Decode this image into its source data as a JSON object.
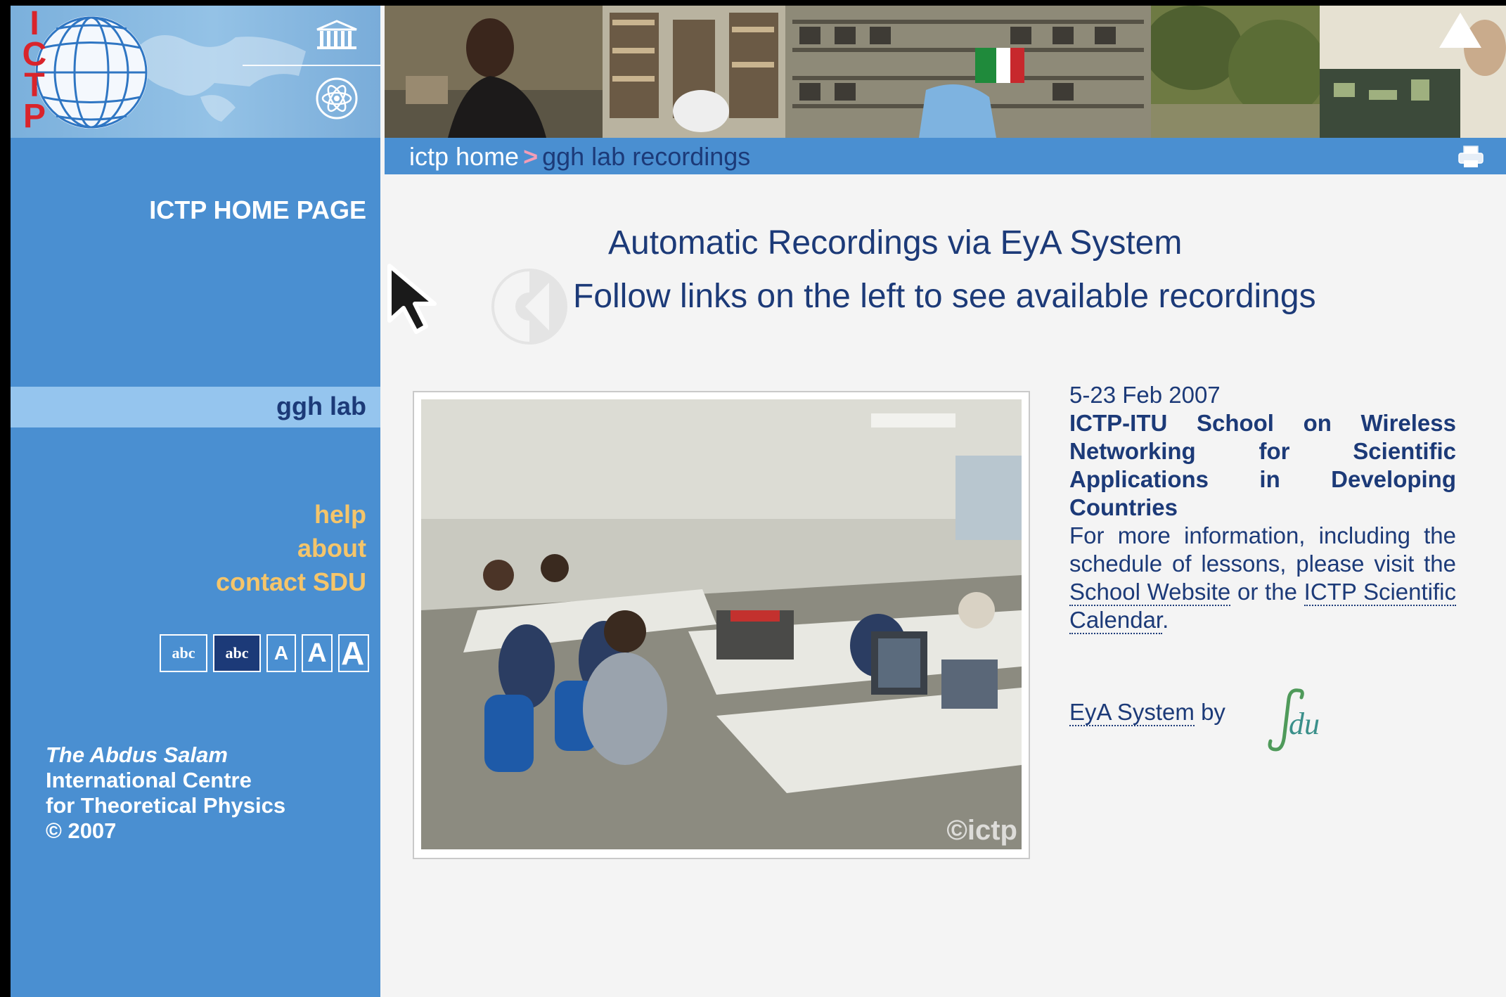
{
  "header": {
    "logo_letters": "ICTP"
  },
  "breadcrumb": {
    "home": "ictp home",
    "separator": ">",
    "current": "ggh lab recordings"
  },
  "sidebar": {
    "home_link": "ICTP HOME PAGE",
    "selected_item": "ggh lab",
    "links": [
      "help",
      "about",
      "contact SDU"
    ],
    "font_controls": [
      "abc",
      "abc",
      "A",
      "A",
      "A"
    ],
    "copyright": {
      "line1": "The Abdus Salam",
      "line2": "International Centre",
      "line3": "for Theoretical Physics",
      "line4": "© 2007"
    }
  },
  "main": {
    "headline": "Automatic Recordings via EyA System",
    "subline": "Follow links on the left to see available recordings",
    "photo_credit": "©ictp"
  },
  "event": {
    "date": "5-23 Feb 2007",
    "title": "ICTP-ITU School on Wireless Networking for Scientific Applications in Developing Countries",
    "more_prefix": "For more information, including the schedule of lessons, please visit the",
    "school_link": "School Website",
    "more_middle": "or the",
    "calendar_link": "ICTP Scientific Calendar",
    "more_suffix": "."
  },
  "footer_credit": {
    "eya_link": "EyA System",
    "by": "by",
    "sdu_logo_text": "du"
  },
  "colors": {
    "sidebar_blue": "#4a8fd1",
    "selected_row": "#95c5ee",
    "link_orange": "#f5c56a",
    "text_navy": "#1c3a78",
    "logo_red": "#d9242b"
  },
  "icons": [
    "unesco-icon",
    "iaea-icon",
    "print-icon",
    "back-arrow-icon",
    "cursor-icon"
  ]
}
